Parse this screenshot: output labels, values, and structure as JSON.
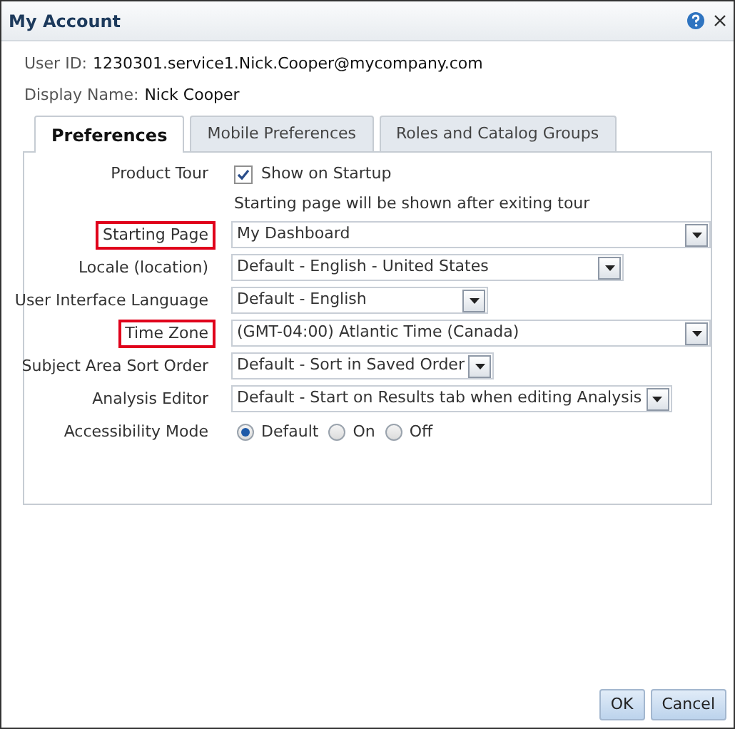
{
  "window": {
    "title": "My Account"
  },
  "user_id": {
    "label": "User ID:",
    "value": "1230301.service1.Nick.Cooper@mycompany.com"
  },
  "display_name": {
    "label": "Display Name:",
    "value": "Nick Cooper"
  },
  "tabs": [
    {
      "label": "Preferences",
      "selected": true
    },
    {
      "label": "Mobile Preferences",
      "selected": false
    },
    {
      "label": "Roles and Catalog Groups",
      "selected": false
    }
  ],
  "form": [
    {
      "kind": "checkbox",
      "label": "Product Tour",
      "highlighted": false,
      "option": "Show on Startup",
      "checked": true,
      "note": "Starting page will be shown after exiting tour"
    },
    {
      "kind": "select",
      "label": "Starting Page",
      "highlighted": true,
      "value": "My Dashboard"
    },
    {
      "kind": "select",
      "label": "Locale (location)",
      "highlighted": false,
      "value": "Default - English - United States"
    },
    {
      "kind": "select",
      "label": "User Interface Language",
      "highlighted": false,
      "value": "Default - English"
    },
    {
      "kind": "select",
      "label": "Time Zone",
      "highlighted": true,
      "value": "(GMT-04:00) Atlantic Time (Canada)"
    },
    {
      "kind": "select",
      "label": "Subject Area Sort Order",
      "highlighted": false,
      "value": "Default - Sort in Saved Order"
    },
    {
      "kind": "select",
      "label": "Analysis Editor",
      "highlighted": false,
      "value": "Default - Start on Results tab when editing Analysis"
    },
    {
      "kind": "radio",
      "label": "Accessibility Mode",
      "highlighted": false,
      "options": [
        {
          "label": "Default",
          "selected": true
        },
        {
          "label": "On",
          "selected": false
        },
        {
          "label": "Off",
          "selected": false
        }
      ]
    }
  ],
  "buttons": [
    "OK",
    "Cancel"
  ]
}
